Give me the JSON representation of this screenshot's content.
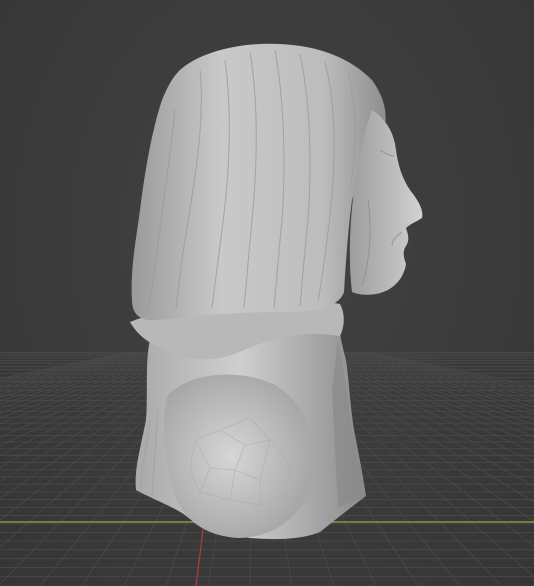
{
  "viewport": {
    "background_color": "#3d3d3d",
    "grid_color": "#4a4a4a",
    "x_axis_color": "#8fb03a",
    "y_axis_color": "#b33a3a",
    "mesh_color": "#c8c8c8",
    "mesh_shadow_color": "#8f8f8f",
    "object": "sculpted-bust-mesh"
  }
}
